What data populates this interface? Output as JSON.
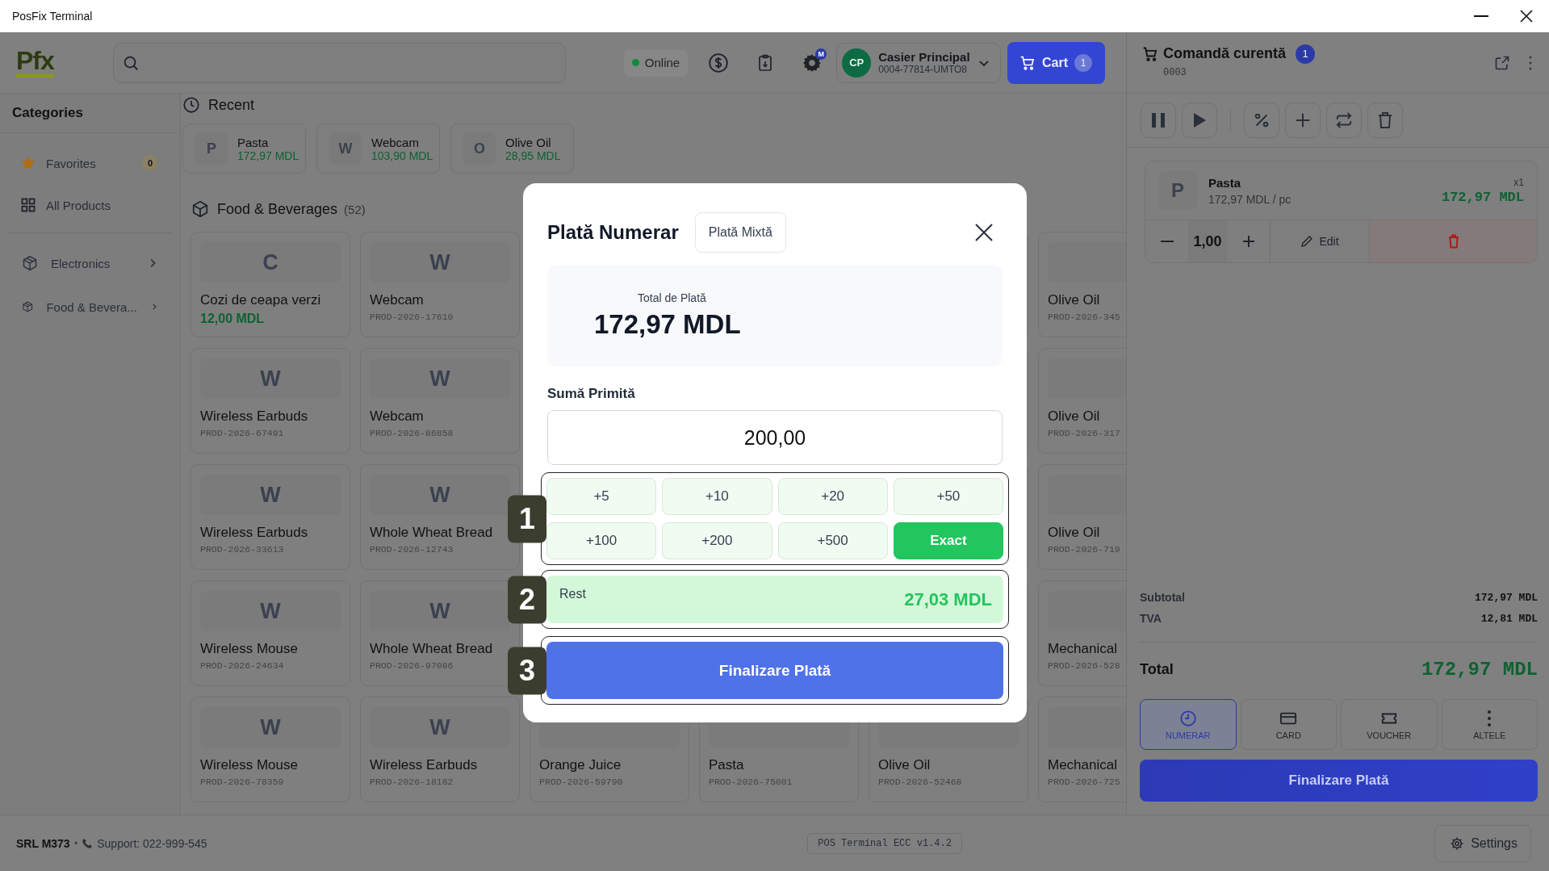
{
  "window": {
    "title": "PosFix Terminal"
  },
  "header": {
    "logo": "Pfx",
    "status": {
      "label": "Online",
      "online": true
    },
    "settings_badge": "M",
    "user": {
      "initials": "CP",
      "name": "Casier Principal",
      "id": "0004-77814-UMTO8"
    },
    "cart": {
      "label": "Cart",
      "count": "1"
    }
  },
  "sidebar": {
    "title": "Categories",
    "items": [
      {
        "kind": "favorites",
        "label": "Favorites",
        "badge": "0"
      },
      {
        "kind": "all",
        "label": "All Products"
      },
      {
        "kind": "category",
        "label": "Electronics"
      },
      {
        "kind": "category",
        "label": "Food & Bevera..."
      }
    ]
  },
  "recent": {
    "title": "Recent",
    "items": [
      {
        "letter": "P",
        "name": "Pasta",
        "price": "172,97 MDL"
      },
      {
        "letter": "W",
        "name": "Webcam",
        "price": "103,90 MDL"
      },
      {
        "letter": "O",
        "name": "Olive Oil",
        "price": "28,95 MDL"
      }
    ]
  },
  "section": {
    "title": "Food & Beverages",
    "count": "(52)"
  },
  "product_rows": [
    {
      "cards": [
        {
          "kind": "product",
          "letter": "C",
          "name": "Cozi de ceapa verzi",
          "price": "12,00 MDL"
        },
        {
          "kind": "product",
          "letter": "W",
          "name": "Webcam",
          "sku": "PROD-2026-17610"
        },
        {
          "kind": "hidden"
        },
        {
          "kind": "hidden"
        },
        {
          "kind": "hidden"
        },
        {
          "kind": "product",
          "name": "Olive Oil",
          "sku": "PROD-2026-345"
        }
      ]
    },
    {
      "cards": [
        {
          "kind": "product",
          "letter": "W",
          "name": "Wireless Earbuds",
          "sku": "PROD-2026-67491"
        },
        {
          "kind": "product",
          "letter": "W",
          "name": "Webcam",
          "sku": "PROD-2026-86858"
        },
        {
          "kind": "hidden"
        },
        {
          "kind": "hidden"
        },
        {
          "kind": "hidden"
        },
        {
          "kind": "product",
          "name": "Olive Oil",
          "sku": "PROD-2026-317"
        }
      ]
    },
    {
      "cards": [
        {
          "kind": "product",
          "letter": "W",
          "name": "Wireless Earbuds",
          "sku": "PROD-2026-33613"
        },
        {
          "kind": "product",
          "letter": "W",
          "name": "Whole Wheat Bread",
          "sku": "PROD-2026-12743"
        },
        {
          "kind": "hidden"
        },
        {
          "kind": "hidden"
        },
        {
          "kind": "hidden"
        },
        {
          "kind": "product",
          "name": "Olive Oil",
          "sku": "PROD-2026-719"
        }
      ]
    },
    {
      "cards": [
        {
          "kind": "product",
          "letter": "W",
          "name": "Wireless Mouse",
          "sku": "PROD-2026-24634"
        },
        {
          "kind": "product",
          "letter": "W",
          "name": "Whole Wheat Bread",
          "sku": "PROD-2026-97086"
        },
        {
          "kind": "hidden"
        },
        {
          "kind": "hidden"
        },
        {
          "kind": "hidden"
        },
        {
          "kind": "product",
          "name": "Mechanical",
          "sku": "PROD-2026-528"
        }
      ]
    },
    {
      "cards": [
        {
          "kind": "product",
          "letter": "W",
          "name": "Wireless Mouse",
          "sku": "PROD-2026-78359"
        },
        {
          "kind": "product",
          "letter": "W",
          "name": "Wireless Earbuds",
          "sku": "PROD-2026-18182"
        },
        {
          "kind": "product",
          "name": "Orange Juice",
          "sku": "PROD-2026-59790"
        },
        {
          "kind": "product",
          "name": "Pasta",
          "sku": "PROD-2026-75001"
        },
        {
          "kind": "product",
          "name": "Olive Oil",
          "sku": "PROD-2026-52468"
        },
        {
          "kind": "product",
          "name": "Mechanical",
          "sku": "PROD-2026-725"
        }
      ]
    }
  ],
  "order": {
    "title": "Comandă curentă",
    "count": "1",
    "number": "0003",
    "items": [
      {
        "letter": "P",
        "name": "Pasta",
        "unit_price": "172,97 MDL / pc",
        "multiplier": "x1",
        "total": "172,97 MDL",
        "quantity": "1,00",
        "edit_label": "Edit"
      }
    ],
    "totals": [
      {
        "kind": "sub",
        "label": "Subtotal",
        "value": "172,97 MDL"
      },
      {
        "kind": "sub",
        "label": "TVA",
        "value": "12,81 MDL"
      },
      {
        "kind": "grand",
        "label": "Total",
        "value": "172,97 MDL"
      }
    ],
    "payment_methods": [
      {
        "kind": "cash",
        "label": "NUMERAR",
        "selected": true
      },
      {
        "kind": "card",
        "label": "CARD",
        "selected": false
      },
      {
        "kind": "voucher",
        "label": "VOUCHER",
        "selected": false
      },
      {
        "kind": "more",
        "label": "ALTELE",
        "selected": false
      }
    ],
    "finish_label": "Finalizare Plată"
  },
  "footer": {
    "company": "SRL M373",
    "separator": "•",
    "support": "Support: 022-999-545",
    "version": "POS Terminal ECC v1.4.2",
    "settings": "Settings"
  },
  "dialog": {
    "title": "Plată Numerar",
    "alt_tab": "Plată Mixtă",
    "total_label": "Total de Plată",
    "total": "172,97 MDL",
    "received_label": "Sumă Primită",
    "received_value": "200,00",
    "quick_amounts": [
      {
        "kind": "add",
        "label": "+5"
      },
      {
        "kind": "add",
        "label": "+10"
      },
      {
        "kind": "add",
        "label": "+20"
      },
      {
        "kind": "add",
        "label": "+50"
      },
      {
        "kind": "add",
        "label": "+100"
      },
      {
        "kind": "add",
        "label": "+200"
      },
      {
        "kind": "add",
        "label": "+500"
      },
      {
        "kind": "exact",
        "label": "Exact"
      }
    ],
    "change_label": "Rest",
    "change": "27,03 MDL",
    "finish_label": "Finalizare Plată"
  },
  "tour_steps": [
    "1",
    "2",
    "3"
  ]
}
